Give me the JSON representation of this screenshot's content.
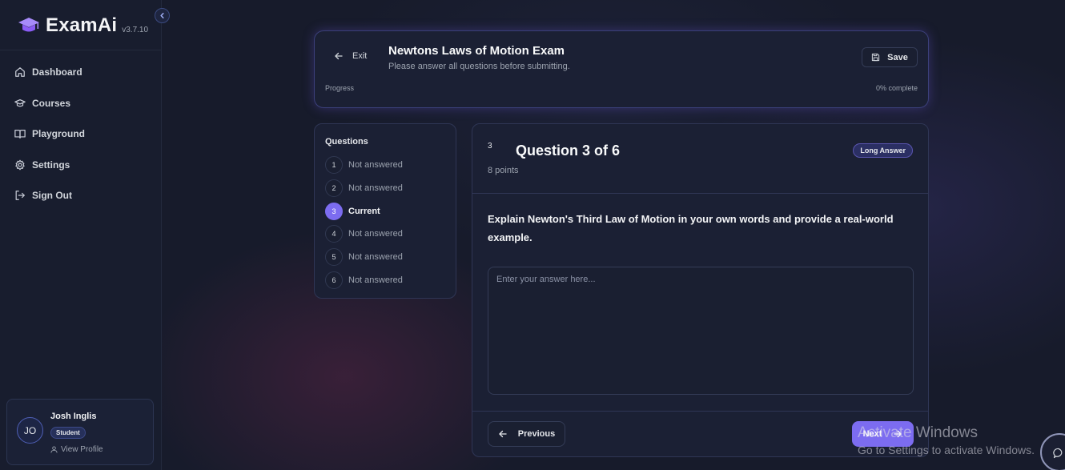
{
  "app": {
    "name": "ExamAi",
    "version": "v3.7.10"
  },
  "sidebar": {
    "items": [
      {
        "label": "Dashboard",
        "icon": "home-icon"
      },
      {
        "label": "Courses",
        "icon": "graduation-cap-icon"
      },
      {
        "label": "Playground",
        "icon": "book-open-icon"
      },
      {
        "label": "Settings",
        "icon": "gear-icon"
      },
      {
        "label": "Sign Out",
        "icon": "sign-out-icon"
      }
    ]
  },
  "user": {
    "initials": "JO",
    "name": "Josh Inglis",
    "role": "Student",
    "view_profile": "View Profile"
  },
  "header": {
    "exit_label": "Exit",
    "title": "Newtons Laws of Motion Exam",
    "subtitle": "Please answer all questions before submitting.",
    "save_label": "Save",
    "progress_label": "Progress",
    "progress_text": "0% complete",
    "progress_value": 0
  },
  "questions_panel": {
    "title": "Questions",
    "items": [
      {
        "number": "1",
        "status": "Not answered"
      },
      {
        "number": "2",
        "status": "Not answered"
      },
      {
        "number": "3",
        "status": "Current"
      },
      {
        "number": "4",
        "status": "Not answered"
      },
      {
        "number": "5",
        "status": "Not answered"
      },
      {
        "number": "6",
        "status": "Not answered"
      }
    ]
  },
  "question": {
    "index": "3",
    "heading": "Question 3 of 6",
    "points": "8 points",
    "type": "Long Answer",
    "text": "Explain Newton's Third Law of Motion in your own words and provide a real-world example.",
    "answer_value": "",
    "answer_placeholder": "Enter your answer here...",
    "previous_label": "Previous",
    "next_label": "Next"
  },
  "watermark": {
    "line1": "Activate Windows",
    "line2": "Go to Settings to activate Windows."
  },
  "colors": {
    "accent": "#7c6cf0",
    "background": "#171b2b",
    "card": "#1b2034"
  }
}
